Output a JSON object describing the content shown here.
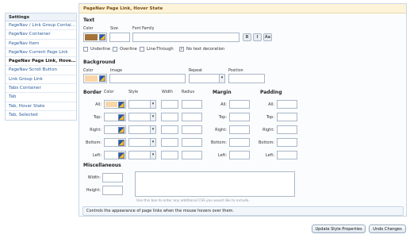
{
  "sidebar": {
    "heading": "Settings",
    "items": [
      {
        "label": "PageNav / Link Group Container"
      },
      {
        "label": "PageNav Container"
      },
      {
        "label": "PageNav Item"
      },
      {
        "label": "PageNav Current Page Link"
      },
      {
        "label": "PageNav Page Link, Hover St..."
      },
      {
        "label": "PageNav Scroll Button"
      },
      {
        "label": "Link Group Link"
      },
      {
        "label": "Tabs Container"
      },
      {
        "label": "Tab"
      },
      {
        "label": "Tab, Hover State"
      },
      {
        "label": "Tab, Selected"
      }
    ],
    "active_index": 4
  },
  "panel": {
    "title": "PageNav Page Link, Hover State",
    "text_section": {
      "heading": "Text",
      "color_label": "Color",
      "size_label": "Size",
      "font_family_label": "Font Family",
      "color_value": "#a3733a",
      "size_value": "",
      "font_family_value": "",
      "format_buttons": [
        "B",
        "I",
        "Aa"
      ],
      "decorations": [
        {
          "label": "Underline",
          "checked": false
        },
        {
          "label": "Overline",
          "checked": false
        },
        {
          "label": "Line-Through",
          "checked": false
        },
        {
          "label": "No text decoration",
          "checked": true
        }
      ]
    },
    "background_section": {
      "heading": "Background",
      "color_label": "Color",
      "image_label": "Image",
      "repeat_label": "Repeat",
      "position_label": "Position",
      "color_value": "#f9d6a8"
    },
    "border_section": {
      "heading": "Border",
      "col_color": "Color",
      "col_style": "Style",
      "col_width": "Width",
      "col_radius": "Radius",
      "rows": [
        "All:",
        "Top:",
        "Right:",
        "Bottom:",
        "Left:"
      ],
      "all_color": "#f9d6a8"
    },
    "margin_section": {
      "heading": "Margin",
      "rows": [
        "All:",
        "Top:",
        "Right:",
        "Bottom:",
        "Left:"
      ]
    },
    "padding_section": {
      "heading": "Padding",
      "rows": [
        "All:",
        "Top:",
        "Right:",
        "Bottom:",
        "Left:"
      ]
    },
    "misc_section": {
      "heading": "Miscellaneous",
      "width_label": "Width:",
      "height_label": "Height:",
      "css_hint": "Use this box to enter any additional CSS you would like to include."
    },
    "help_text": "Controls the appearance of page links when the mouse hovers over them."
  },
  "buttons": {
    "update": "Update Style Properties",
    "undo": "Undo Changes"
  }
}
